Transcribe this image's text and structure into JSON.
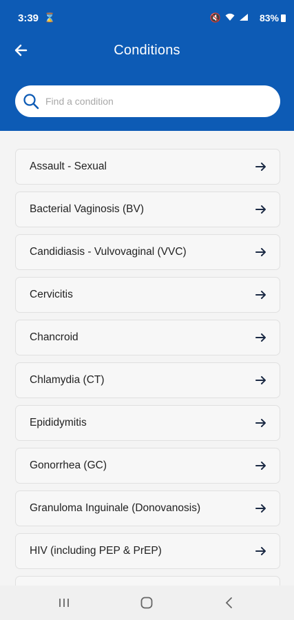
{
  "status_bar": {
    "time": "3:39",
    "battery": "83%"
  },
  "header": {
    "title": "Conditions"
  },
  "search": {
    "placeholder": "Find a condition"
  },
  "conditions": [
    "Assault - Sexual",
    "Bacterial Vaginosis (BV)",
    "Candidiasis - Vulvovaginal (VVC)",
    "Cervicitis",
    "Chancroid",
    "Chlamydia (CT)",
    "Epididymitis",
    "Gonorrhea (GC)",
    "Granuloma Inguinale (Donovanosis)",
    "HIV (including PEP & PrEP)"
  ],
  "colors": {
    "brand_blue": "#0d5bb5",
    "arrow": "#1b2a44"
  }
}
